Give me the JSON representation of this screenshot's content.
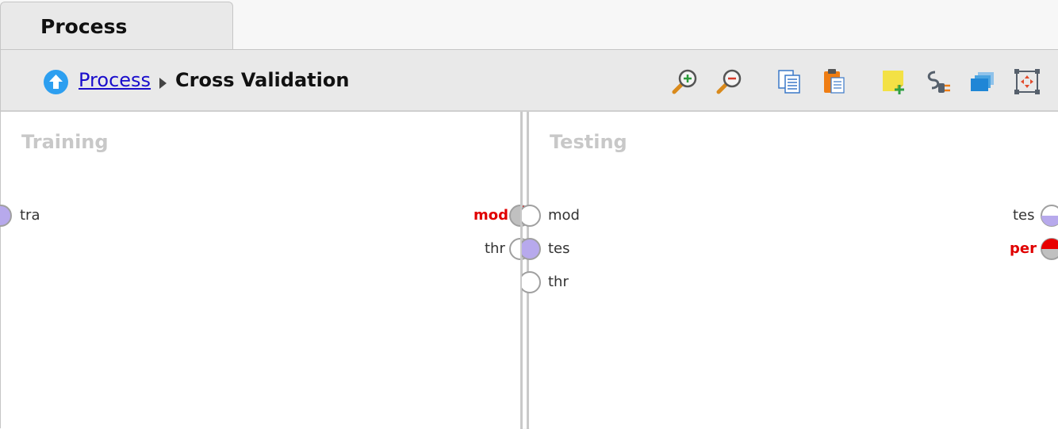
{
  "tab": {
    "label": "Process"
  },
  "breadcrumb": {
    "parent": "Process",
    "current": "Cross Validation"
  },
  "toolbar": {
    "icons": [
      "zoom-in-icon",
      "zoom-out-icon",
      "copy-icon",
      "paste-icon",
      "add-note-icon",
      "auto-wire-icon",
      "layers-icon",
      "fit-view-icon"
    ]
  },
  "training": {
    "title": "Training",
    "inputs": [
      {
        "label": "tra",
        "fill": "#b7a9ec"
      }
    ],
    "outputs": [
      {
        "label": "mod",
        "connected": true,
        "fill": "#e80000"
      },
      {
        "label": "thr",
        "connected": false
      }
    ]
  },
  "testing": {
    "title": "Testing",
    "inputs": [
      {
        "label": "mod",
        "connected": false
      },
      {
        "label": "tes",
        "fill": "#b7a9ec"
      },
      {
        "label": "thr",
        "connected": false
      }
    ],
    "outputs": [
      {
        "label": "tes",
        "fill": "#b7a9ec"
      },
      {
        "label": "per",
        "connected": true,
        "fill": "#e80000"
      }
    ]
  },
  "colors": {
    "link": "#1a0dcc",
    "required": "#e00000",
    "exampleset": "#b7a9ec",
    "title_muted": "#c8c8c8"
  }
}
